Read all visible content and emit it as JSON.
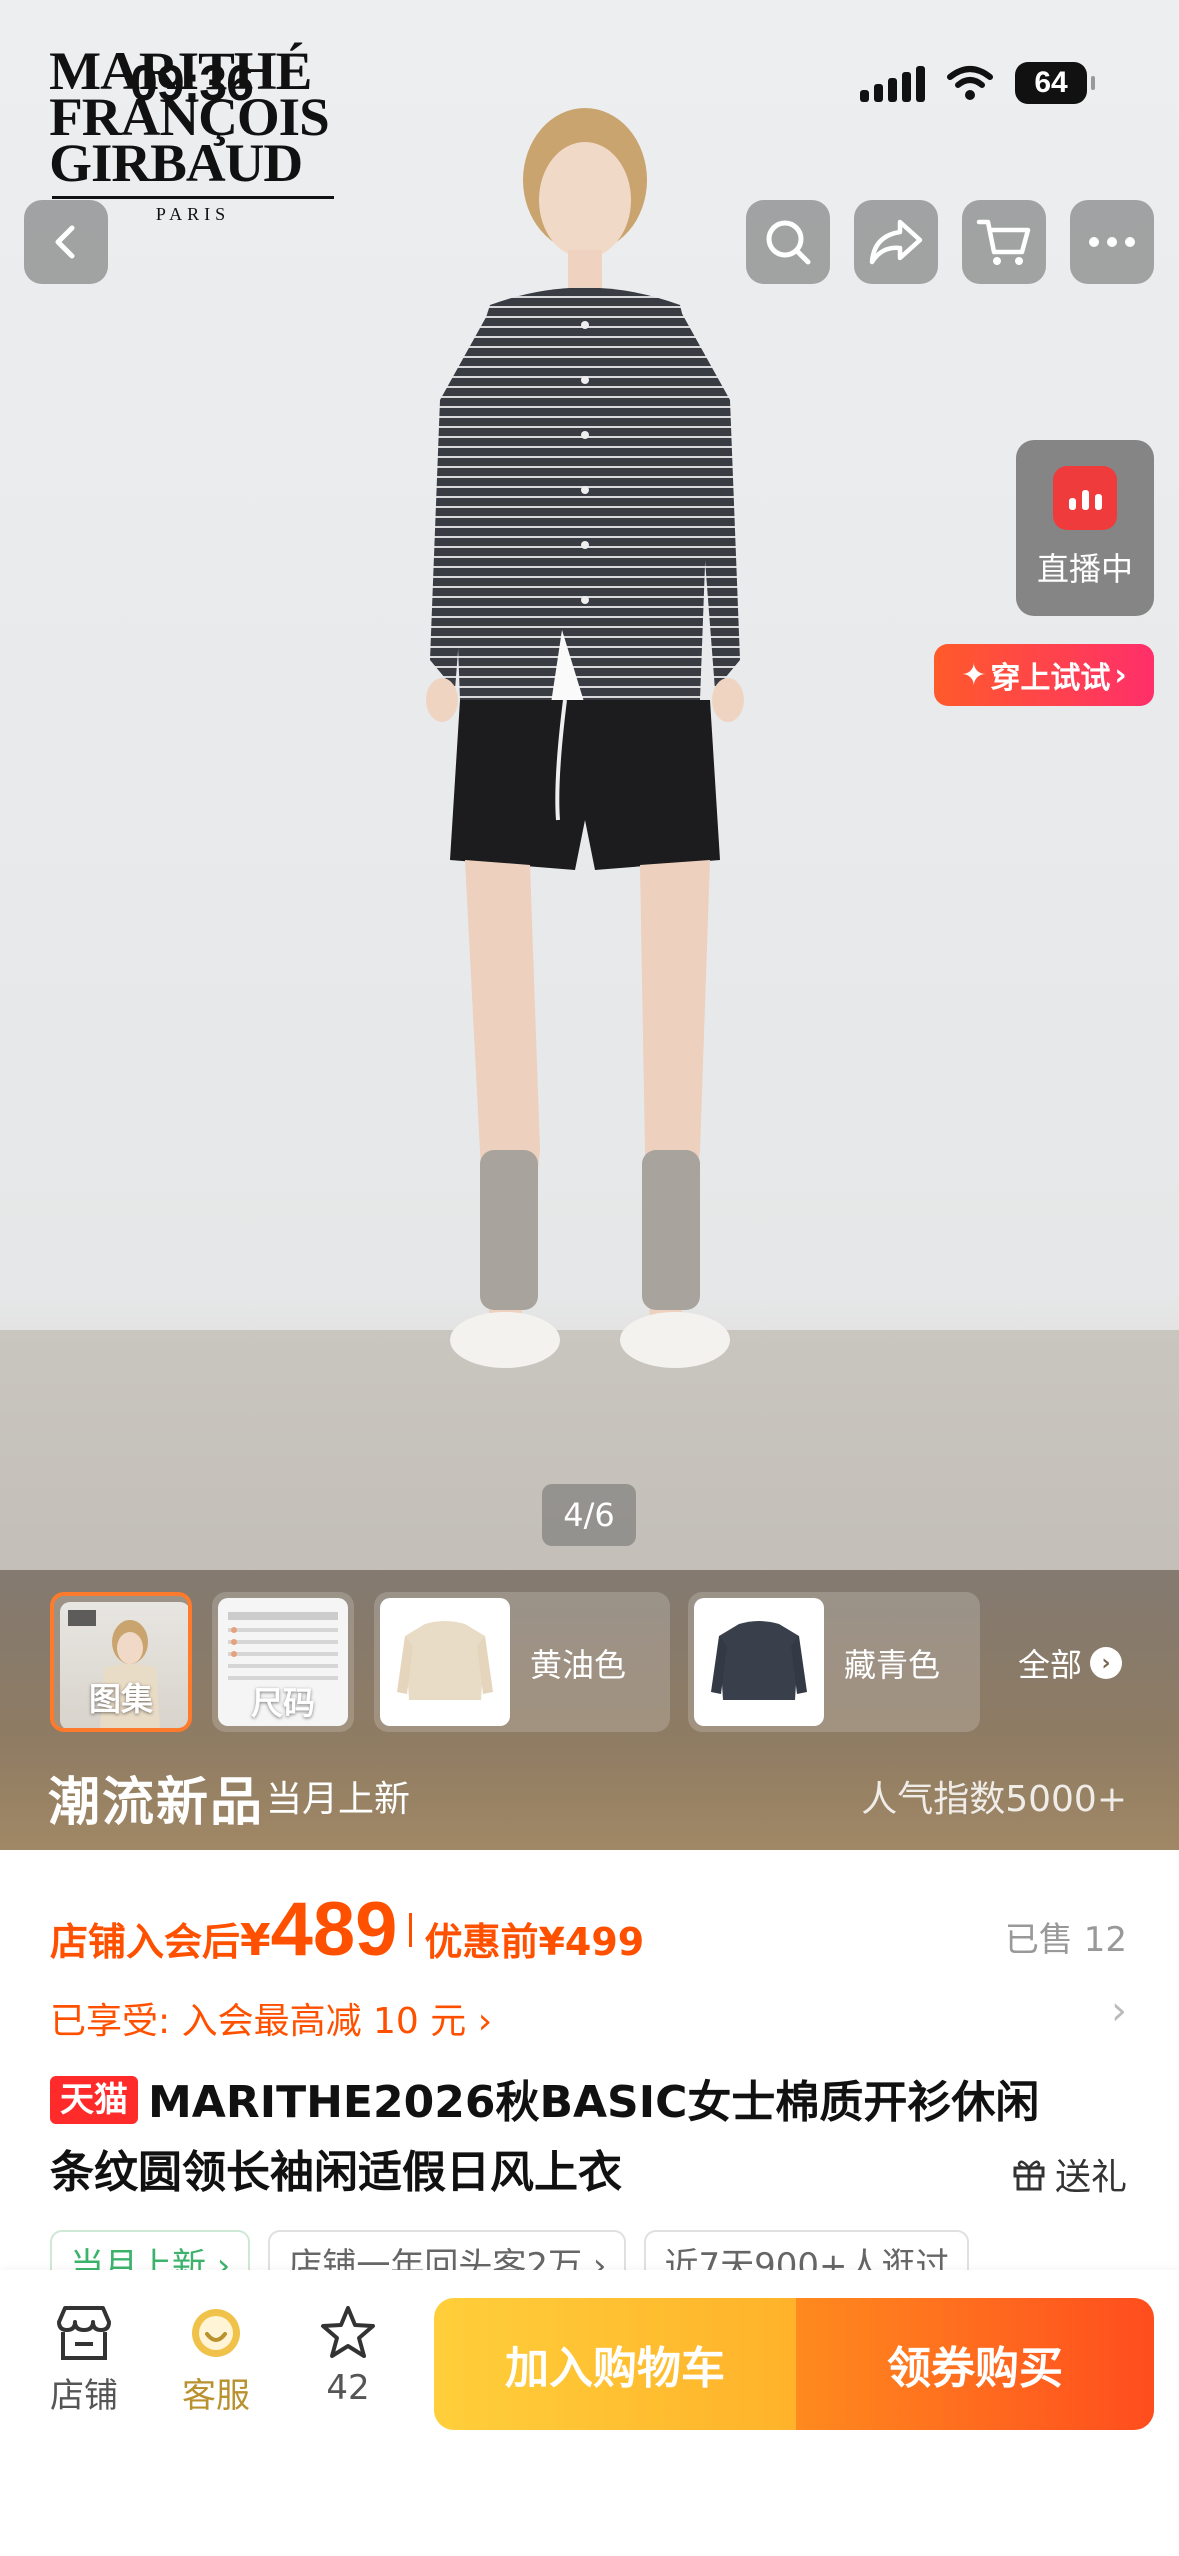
{
  "status_bar": {
    "time": "09:36",
    "battery": "64"
  },
  "brand": {
    "line1": "MARITHÉ",
    "line2": "FRANÇOIS",
    "line3": "GIRBAUD",
    "sub": "PARIS"
  },
  "top_actions": {
    "back_icon": "chevron-left-icon",
    "search_icon": "search-icon",
    "share_icon": "share-icon",
    "cart_icon": "cart-icon",
    "more_icon": "more-icon"
  },
  "live": {
    "label": "直播中"
  },
  "tryon": {
    "label": "穿上试试",
    "star": "✦",
    "arrow": "›"
  },
  "gallery": {
    "indicator": "4/6",
    "current": 4,
    "total": 6
  },
  "thumbs": {
    "gallery_label": "图集",
    "size_label": "尺码",
    "colors": [
      {
        "name": "黄油色",
        "swatch": "#e9dcc6"
      },
      {
        "name": "藏青色",
        "swatch": "#3a3f4c"
      }
    ],
    "all_label": "全部",
    "all_arrow": "›"
  },
  "trend": {
    "title": "潮流新品",
    "sub": "当月上新",
    "popularity": "人气指数5000+"
  },
  "price": {
    "label": "店铺入会后",
    "yen": "¥",
    "value": "489",
    "before": "优惠前¥499",
    "sold": "已售 12",
    "accent": "#ff5000"
  },
  "promo": {
    "text": "已享受: 入会最高减 10 元 ›",
    "arrow": "›"
  },
  "product": {
    "badge": "天猫",
    "title": "MARITHE2026秋BASIC女士棉质开衫休闲条纹圆领长袖闲适假日风上衣",
    "gift": "送礼"
  },
  "chips": [
    "当月上新 ›",
    "店铺一年回头客2万 ›",
    "近7天900+人逛过"
  ],
  "bottom_bar": {
    "store_label": "店铺",
    "service_label": "客服",
    "fav_count": "42",
    "add_cart": "加入购物车",
    "buy": "领券购买"
  }
}
